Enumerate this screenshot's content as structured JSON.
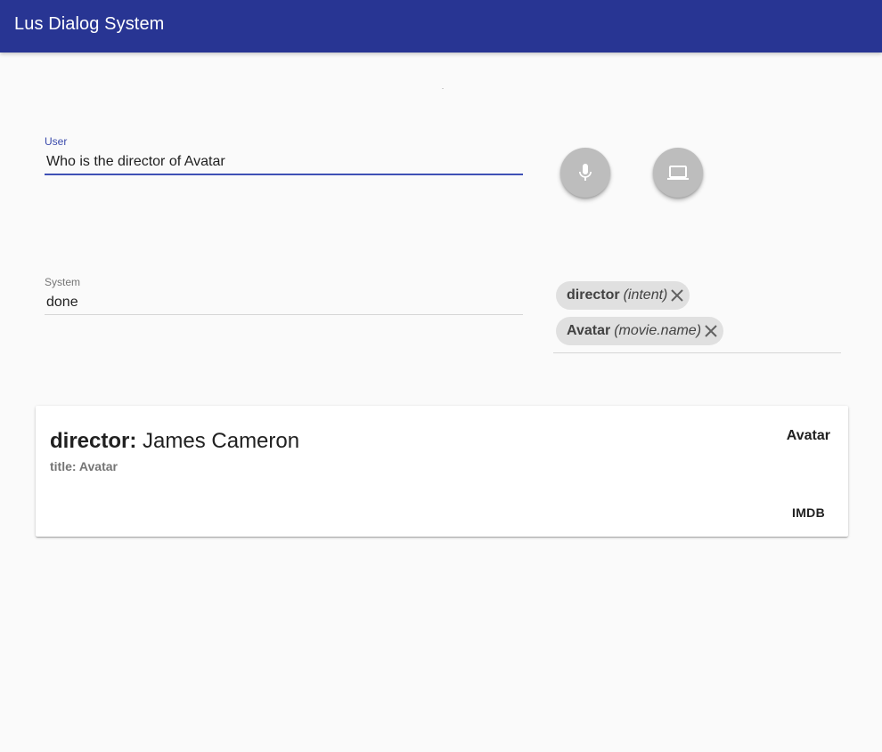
{
  "app": {
    "title": "Lus Dialog System",
    "accent_color": "#283593"
  },
  "user_field": {
    "label": "User",
    "value": "Who is the director of Avatar"
  },
  "system_field": {
    "label": "System",
    "value": "done"
  },
  "buttons": {
    "mic": {
      "icon": "mic-icon"
    },
    "computer": {
      "icon": "laptop-icon"
    }
  },
  "chips": [
    {
      "name": "director",
      "type": "(intent)"
    },
    {
      "name": "Avatar",
      "type": "(movie.name)"
    }
  ],
  "result_card": {
    "key": "director:",
    "value": "James Cameron",
    "subtitle": "title: Avatar",
    "tag": "Avatar",
    "action": "IMDB"
  }
}
